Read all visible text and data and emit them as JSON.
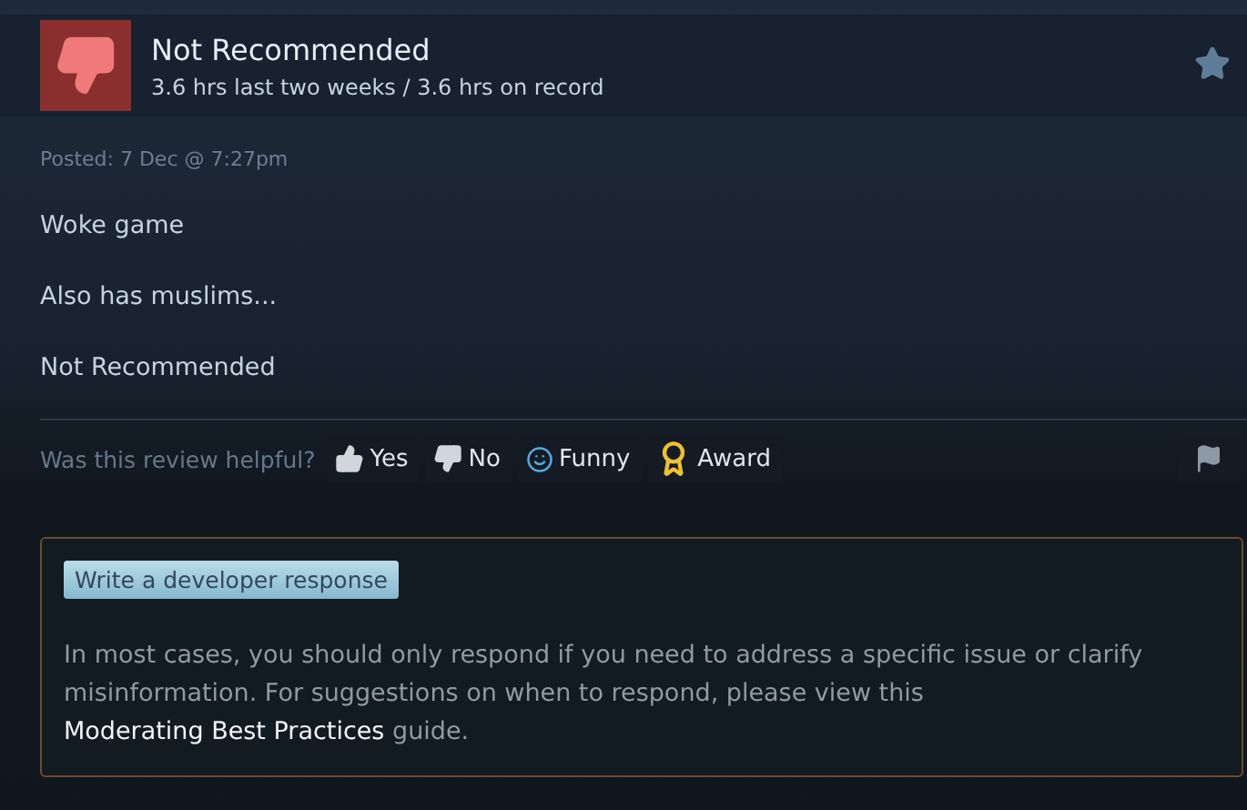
{
  "review": {
    "verdict": "Not Recommended",
    "recommended": false,
    "playtime": "3.6 hrs last two weeks / 3.6 hrs on record",
    "posted": "Posted: 7 Dec @ 7:27pm",
    "paragraphs": [
      "Woke game",
      "Also has muslims...",
      "Not Recommended"
    ]
  },
  "helpful": {
    "prompt": "Was this review helpful?",
    "buttons": [
      {
        "kind": "yes",
        "label": "Yes"
      },
      {
        "kind": "no",
        "label": "No"
      },
      {
        "kind": "funny",
        "label": "Funny"
      },
      {
        "kind": "award",
        "label": "Award"
      }
    ]
  },
  "developer_response": {
    "button": "Write a developer response",
    "note_before": "In most cases, you should only respond if you need to address a specific issue or clarify misinformation. For suggestions on when to respond, please view this",
    "link": "Moderating Best Practices",
    "note_after": "guide."
  }
}
